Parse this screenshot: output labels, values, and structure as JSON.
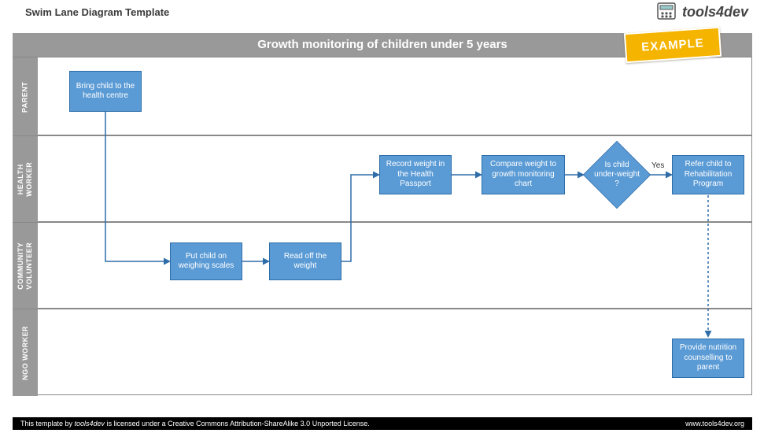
{
  "page": {
    "title": "Swim Lane Diagram Template",
    "brand": "tools4dev",
    "example_badge": "EXAMPLE"
  },
  "diagram": {
    "title": "Growth monitoring of children under 5 years",
    "lanes": [
      {
        "id": "parent",
        "label": "PARENT"
      },
      {
        "id": "health",
        "label": "HEALTH\nWORKER"
      },
      {
        "id": "community",
        "label": "COMMUNITY\nVOLUNTEER"
      },
      {
        "id": "ngo",
        "label": "NGO WORKER"
      }
    ],
    "nodes": {
      "bring": {
        "label": "Bring child to the health centre"
      },
      "weigh": {
        "label": "Put child on weighing scales"
      },
      "read": {
        "label": "Read off the weight"
      },
      "record": {
        "label": "Record weight in the Health Passport"
      },
      "compare": {
        "label": "Compare weight to growth monitoring chart"
      },
      "decision": {
        "label": "Is child under-weight ?"
      },
      "refer": {
        "label": "Refer child to Rehabilitation Program"
      },
      "counsel": {
        "label": "Provide nutrition counselling to parent"
      }
    },
    "edges": {
      "decision_yes": "Yes"
    }
  },
  "footer": {
    "license_prefix": "This template by ",
    "license_brand": "tools4dev",
    "license_suffix": " is licensed under a Creative Commons Attribution-ShareAlike 3.0 Unported License.",
    "url": "www.tools4dev.org"
  }
}
